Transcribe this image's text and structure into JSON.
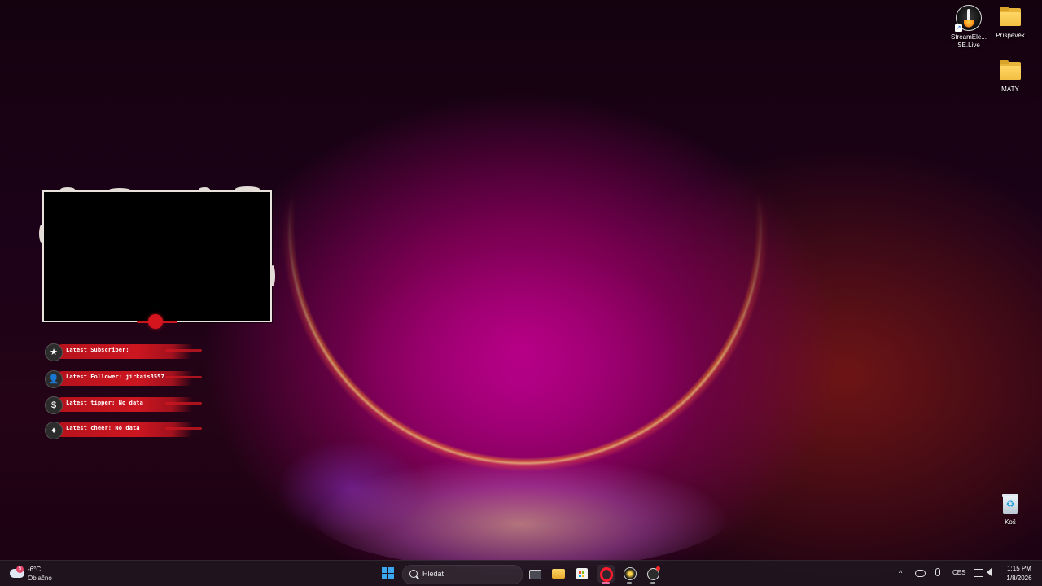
{
  "desktop": {
    "icons": [
      {
        "name": "StreamElements SE.Live",
        "line1": "StreamEle...",
        "line2": "SE.Live",
        "icon": "streamelements-icon"
      },
      {
        "name": "Příspěvěk",
        "label": "Příspěvěk",
        "icon": "folder-icon"
      },
      {
        "name": "MATY",
        "label": "MATY",
        "icon": "folder-icon"
      },
      {
        "name": "Koš",
        "label": "Koš",
        "icon": "recycle-bin-icon"
      }
    ]
  },
  "overlay": {
    "alerts": [
      {
        "icon": "star-icon",
        "glyph": "★",
        "text": "Latest Subscriber:"
      },
      {
        "icon": "user-icon",
        "glyph": "👤",
        "text": "Latest Follower: jirkais3557"
      },
      {
        "icon": "dollar-icon",
        "glyph": "$",
        "text": "Latest tipper: No data"
      },
      {
        "icon": "diamond-icon",
        "glyph": "♦",
        "text": "Latest cheer: No data"
      }
    ],
    "colors": {
      "accent": "#d5141e",
      "frame": "#eae3dd"
    }
  },
  "taskbar": {
    "weather": {
      "temp": "-6°C",
      "condition": "Oblačno",
      "badge": "5"
    },
    "search": {
      "label": "Hledat"
    },
    "apps": [
      {
        "name": "task-view",
        "icon": "task-view-icon"
      },
      {
        "name": "file-explorer",
        "icon": "folder-icon"
      },
      {
        "name": "microsoft-store",
        "icon": "store-icon"
      },
      {
        "name": "opera",
        "icon": "opera-icon",
        "active": true
      },
      {
        "name": "streamelements",
        "icon": "streamelements-icon"
      },
      {
        "name": "obs",
        "icon": "obs-icon"
      }
    ],
    "tray": {
      "chevron": "^",
      "language": "CES",
      "time": "1:15 PM",
      "date": "1/8/2026"
    }
  }
}
